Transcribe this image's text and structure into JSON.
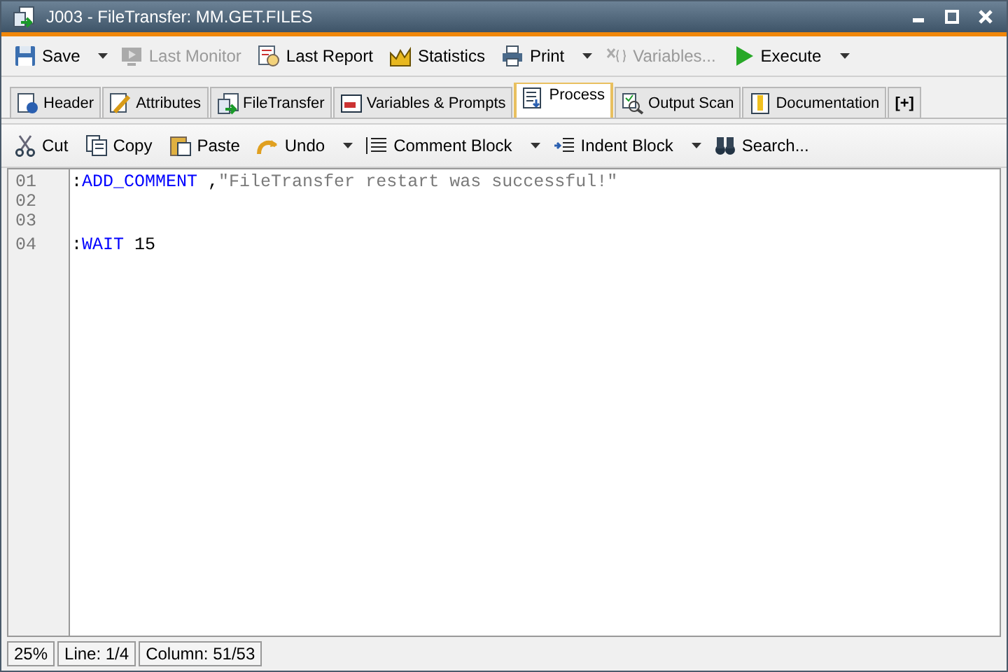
{
  "window": {
    "title": "J003 - FileTransfer: MM.GET.FILES"
  },
  "main_toolbar": [
    {
      "label": "Save",
      "disabled": false,
      "dropdown": true
    },
    {
      "label": "Last Monitor",
      "disabled": true,
      "dropdown": false
    },
    {
      "label": "Last Report",
      "disabled": false,
      "dropdown": false
    },
    {
      "label": "Statistics",
      "disabled": false,
      "dropdown": false
    },
    {
      "label": "Print",
      "disabled": false,
      "dropdown": true
    },
    {
      "label": "Variables...",
      "disabled": true,
      "dropdown": false
    },
    {
      "label": "Execute",
      "disabled": false,
      "dropdown": true
    }
  ],
  "tabs": [
    {
      "label": "Header",
      "selected": false
    },
    {
      "label": "Attributes",
      "selected": false
    },
    {
      "label": "FileTransfer",
      "selected": false
    },
    {
      "label": "Variables & Prompts",
      "selected": false
    },
    {
      "label": "Process",
      "selected": true
    },
    {
      "label": "Output Scan",
      "selected": false
    },
    {
      "label": "Documentation",
      "selected": false
    },
    {
      "label": "[+]",
      "selected": false
    }
  ],
  "edit_toolbar": [
    {
      "label": "Cut",
      "dropdown": false
    },
    {
      "label": "Copy",
      "dropdown": false
    },
    {
      "label": "Paste",
      "dropdown": false
    },
    {
      "label": "Undo",
      "dropdown": true
    },
    {
      "label": "Comment Block",
      "dropdown": true
    },
    {
      "label": "Indent Block",
      "dropdown": true
    },
    {
      "label": "Search...",
      "dropdown": false
    }
  ],
  "editor": {
    "lines": [
      {
        "number": "01",
        "tokens": [
          {
            "kind": "plain",
            "text": ":"
          },
          {
            "kind": "keyword",
            "text": "ADD_COMMENT"
          },
          {
            "kind": "plain",
            "text": " ,"
          },
          {
            "kind": "string",
            "text": "\"FileTransfer restart was successful!\""
          }
        ]
      },
      {
        "number": "02"
      },
      {
        "number": "03"
      },
      {
        "number": "04",
        "tokens": [
          {
            "kind": "plain",
            "text": ":"
          },
          {
            "kind": "keyword",
            "text": "WAIT"
          },
          {
            "kind": "plain",
            "text": " 15"
          }
        ]
      }
    ]
  },
  "status_bar": [
    "25%",
    "Line: 1/4",
    "Column: 51/53"
  ]
}
